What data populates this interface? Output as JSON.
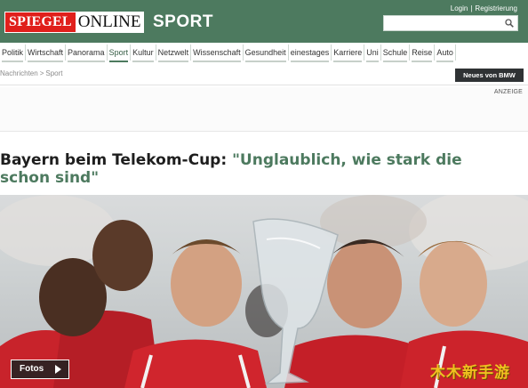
{
  "header": {
    "logo_part1": "SPIEGEL",
    "logo_part2": "ONLINE",
    "section": "SPORT",
    "login": "Login",
    "separator": "|",
    "register": "Registrierung",
    "search_placeholder": "",
    "accent_color": "#4d7a5f"
  },
  "nav": {
    "items": [
      "Politik",
      "Wirtschaft",
      "Panorama",
      "Sport",
      "Kultur",
      "Netzwelt",
      "Wissenschaft",
      "Gesundheit",
      "einestages",
      "Karriere",
      "Uni",
      "Schule",
      "Reise",
      "Auto"
    ],
    "active": "Sport"
  },
  "breadcrumb": {
    "home": "Nachrichten",
    "sep": ">",
    "current": "Sport"
  },
  "bmw_button": "Neues von BMW",
  "ad_label": "ANZEIGE",
  "article": {
    "headline_prefix": "Bayern beim Telekom-Cup:",
    "headline_quote": "\"Unglaublich, wie stark die schon sind\""
  },
  "photo": {
    "fotos_label": "Fotos",
    "watermark": "木木新手游"
  },
  "icons": {
    "search": "search-icon",
    "play": "play-icon"
  }
}
